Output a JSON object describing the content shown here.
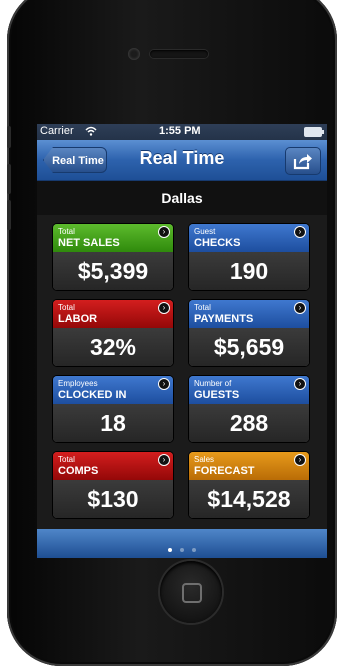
{
  "status_bar": {
    "carrier": "Carrier",
    "time": "1:55 PM"
  },
  "nav": {
    "back_label": "Real Time",
    "title": "Real Time"
  },
  "location": "Dallas",
  "tiles": [
    {
      "top_label": "Total",
      "label": "NET SALES",
      "value": "$5,399",
      "color": "#4aa81e"
    },
    {
      "top_label": "Guest",
      "label": "CHECKS",
      "value": "190",
      "color": "#2f66bb"
    },
    {
      "top_label": "Total",
      "label": "LABOR",
      "value": "32%",
      "color": "#c01414"
    },
    {
      "top_label": "Total",
      "label": "PAYMENTS",
      "value": "$5,659",
      "color": "#2f66bb"
    },
    {
      "top_label": "Employees",
      "label": "CLOCKED IN",
      "value": "18",
      "color": "#2f66bb"
    },
    {
      "top_label": "Number of",
      "label": "GUESTS",
      "value": "288",
      "color": "#2f66bb"
    },
    {
      "top_label": "Total",
      "label": "COMPS",
      "value": "$130",
      "color": "#c01414"
    },
    {
      "top_label": "Sales",
      "label": "FORECAST",
      "value": "$14,528",
      "color": "#d88610"
    }
  ],
  "page_indicator": {
    "pages": 3,
    "current": 1
  },
  "icons": {
    "share": "share-icon",
    "wifi": "wifi-icon",
    "battery": "battery-icon",
    "detail": "detail-arrow-icon",
    "home": "home-button-icon"
  }
}
